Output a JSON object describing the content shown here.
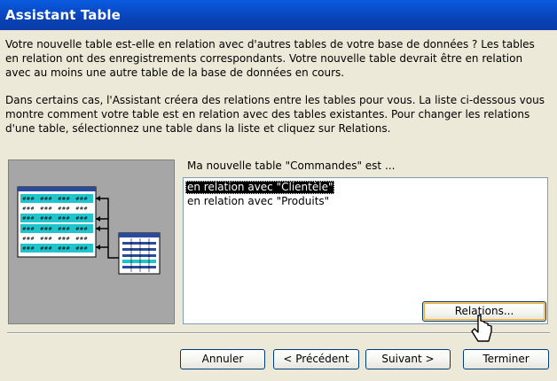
{
  "window": {
    "title": "Assistant Table"
  },
  "intro": {
    "paragraph1": "Votre nouvelle table est-elle en relation avec d'autres tables de votre base de données ? Les tables en relation ont des enregistrements correspondants. Votre nouvelle table devrait être en relation avec au moins une autre table de la base de données en cours.",
    "paragraph2": "Dans certains cas, l'Assistant créera des relations entre les tables pour vous. La liste ci-dessous vous montre comment votre table est en relation avec des tables existantes. Pour changer les relations d'une table, sélectionnez une table dans la liste et cliquez sur Relations."
  },
  "relations_list": {
    "caption": "Ma nouvelle table \"Commandes\" est ...",
    "items": [
      {
        "label": "en relation avec \"Clientèle\"",
        "selected": true
      },
      {
        "label": "en relation avec \"Produits\"",
        "selected": false
      }
    ]
  },
  "buttons": {
    "relations": "Relations...",
    "cancel": "Annuler",
    "previous": "< Précédent",
    "next": "Suivant >",
    "finish": "Terminer"
  },
  "illustration": {
    "cell_text": "###"
  },
  "colors": {
    "title_bar": "#0842b8",
    "dialog_bg": "#ece9d8",
    "table_header": "#2a4a9e",
    "table_cells": "#20c4cc",
    "selection": "#000000"
  }
}
